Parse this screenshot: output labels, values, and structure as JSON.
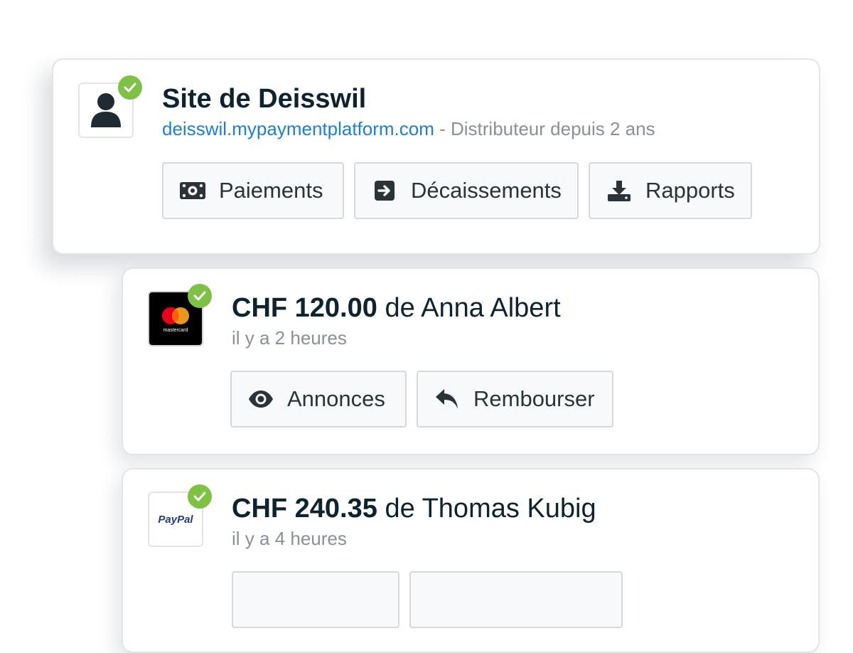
{
  "site": {
    "title": "Site de Deisswil",
    "url": "deisswil.mypaymentplatform.com",
    "meta": " - Distributeur depuis 2 ans",
    "icon": "user-icon",
    "verified_icon": "check-icon",
    "actions": [
      {
        "label": "Paiements",
        "icon": "money-bill-icon"
      },
      {
        "label": "Décaissements",
        "icon": "arrow-right-square-icon"
      },
      {
        "label": "Rapports",
        "icon": "download-icon"
      }
    ]
  },
  "transactions": [
    {
      "amount": "CHF 120.00",
      "from": " de Anna Albert",
      "time": "il y a 2 heures",
      "method": "mastercard",
      "method_label": "mastercard",
      "actions": [
        {
          "label": "Annonces",
          "icon": "eye-icon"
        },
        {
          "label": "Rembourser",
          "icon": "reply-icon"
        }
      ]
    },
    {
      "amount": "CHF 240.35",
      "from": " de Thomas Kubig",
      "time": "il y a 4 heures",
      "method": "paypal",
      "method_label": "PayPal",
      "actions": []
    }
  ],
  "colors": {
    "verified": "#7dc242",
    "link": "#1c7ed6",
    "title": "#0d2330",
    "muted": "#8a9096"
  }
}
